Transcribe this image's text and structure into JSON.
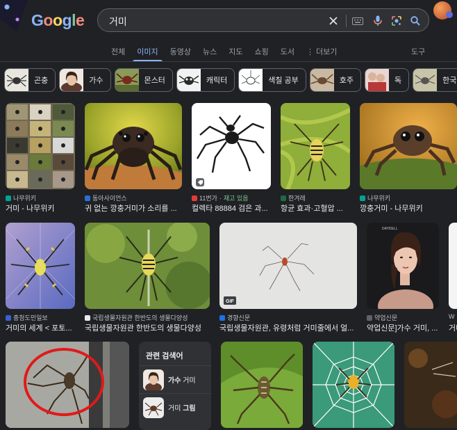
{
  "header": {
    "logo": [
      "G",
      "o",
      "o",
      "g",
      "l",
      "e"
    ],
    "search": {
      "value": "거미"
    }
  },
  "tabs": [
    {
      "label": "전체",
      "active": false
    },
    {
      "label": "이미지",
      "active": true
    },
    {
      "label": "동영상",
      "active": false
    },
    {
      "label": "뉴스",
      "active": false
    },
    {
      "label": "지도",
      "active": false
    },
    {
      "label": "쇼핑",
      "active": false
    },
    {
      "label": "도서",
      "active": false
    },
    {
      "label": "⋮ 더보기",
      "active": false
    }
  ],
  "tools_label": "도구",
  "chips": [
    {
      "label": "곤충"
    },
    {
      "label": "가수"
    },
    {
      "label": "몬스터"
    },
    {
      "label": "캐릭터"
    },
    {
      "label": "색칠 공부"
    },
    {
      "label": "호주"
    },
    {
      "label": "독"
    },
    {
      "label": "한국"
    }
  ],
  "results": [
    {
      "source": "나무위키",
      "title": "거미 - 나무위키"
    },
    {
      "source": "동아사이언스",
      "title": "귀 없는 깡충거미가 소리를 ..."
    },
    {
      "source": "11번가",
      "stock": "재고 있음",
      "title": "컬렉타 88884 검은 과..."
    },
    {
      "source": "한겨레",
      "title": "항균 효과·고혈압 ..."
    },
    {
      "source": "나무위키",
      "title": "깡충거미 - 나무위키"
    },
    {
      "source": "충청도민일보",
      "title": "거미의 세계 < 포토..."
    },
    {
      "source": "국립생물자원관 한반도의 생물다양성",
      "title": "국립생물자원관 한반도의 생물다양성"
    },
    {
      "source": "경향신문",
      "title": "국립생물자원관, 유령처럼 거미줄에서 얼..."
    },
    {
      "source": "약업신문",
      "title": "약업신문]가수 거미, ..."
    },
    {
      "source": "W",
      "title": "거미"
    }
  ],
  "badges": {
    "gif": "GIF",
    "daydell": "DAYDELL"
  },
  "related": {
    "heading": "관련 검색어",
    "items": [
      {
        "prefix": "가수",
        "suffix": "거미"
      },
      {
        "prefix": "거미",
        "suffix": "그림"
      }
    ]
  },
  "colors": {
    "background": "#202124",
    "accent": "#8ab4f8",
    "surface": "#303134"
  }
}
